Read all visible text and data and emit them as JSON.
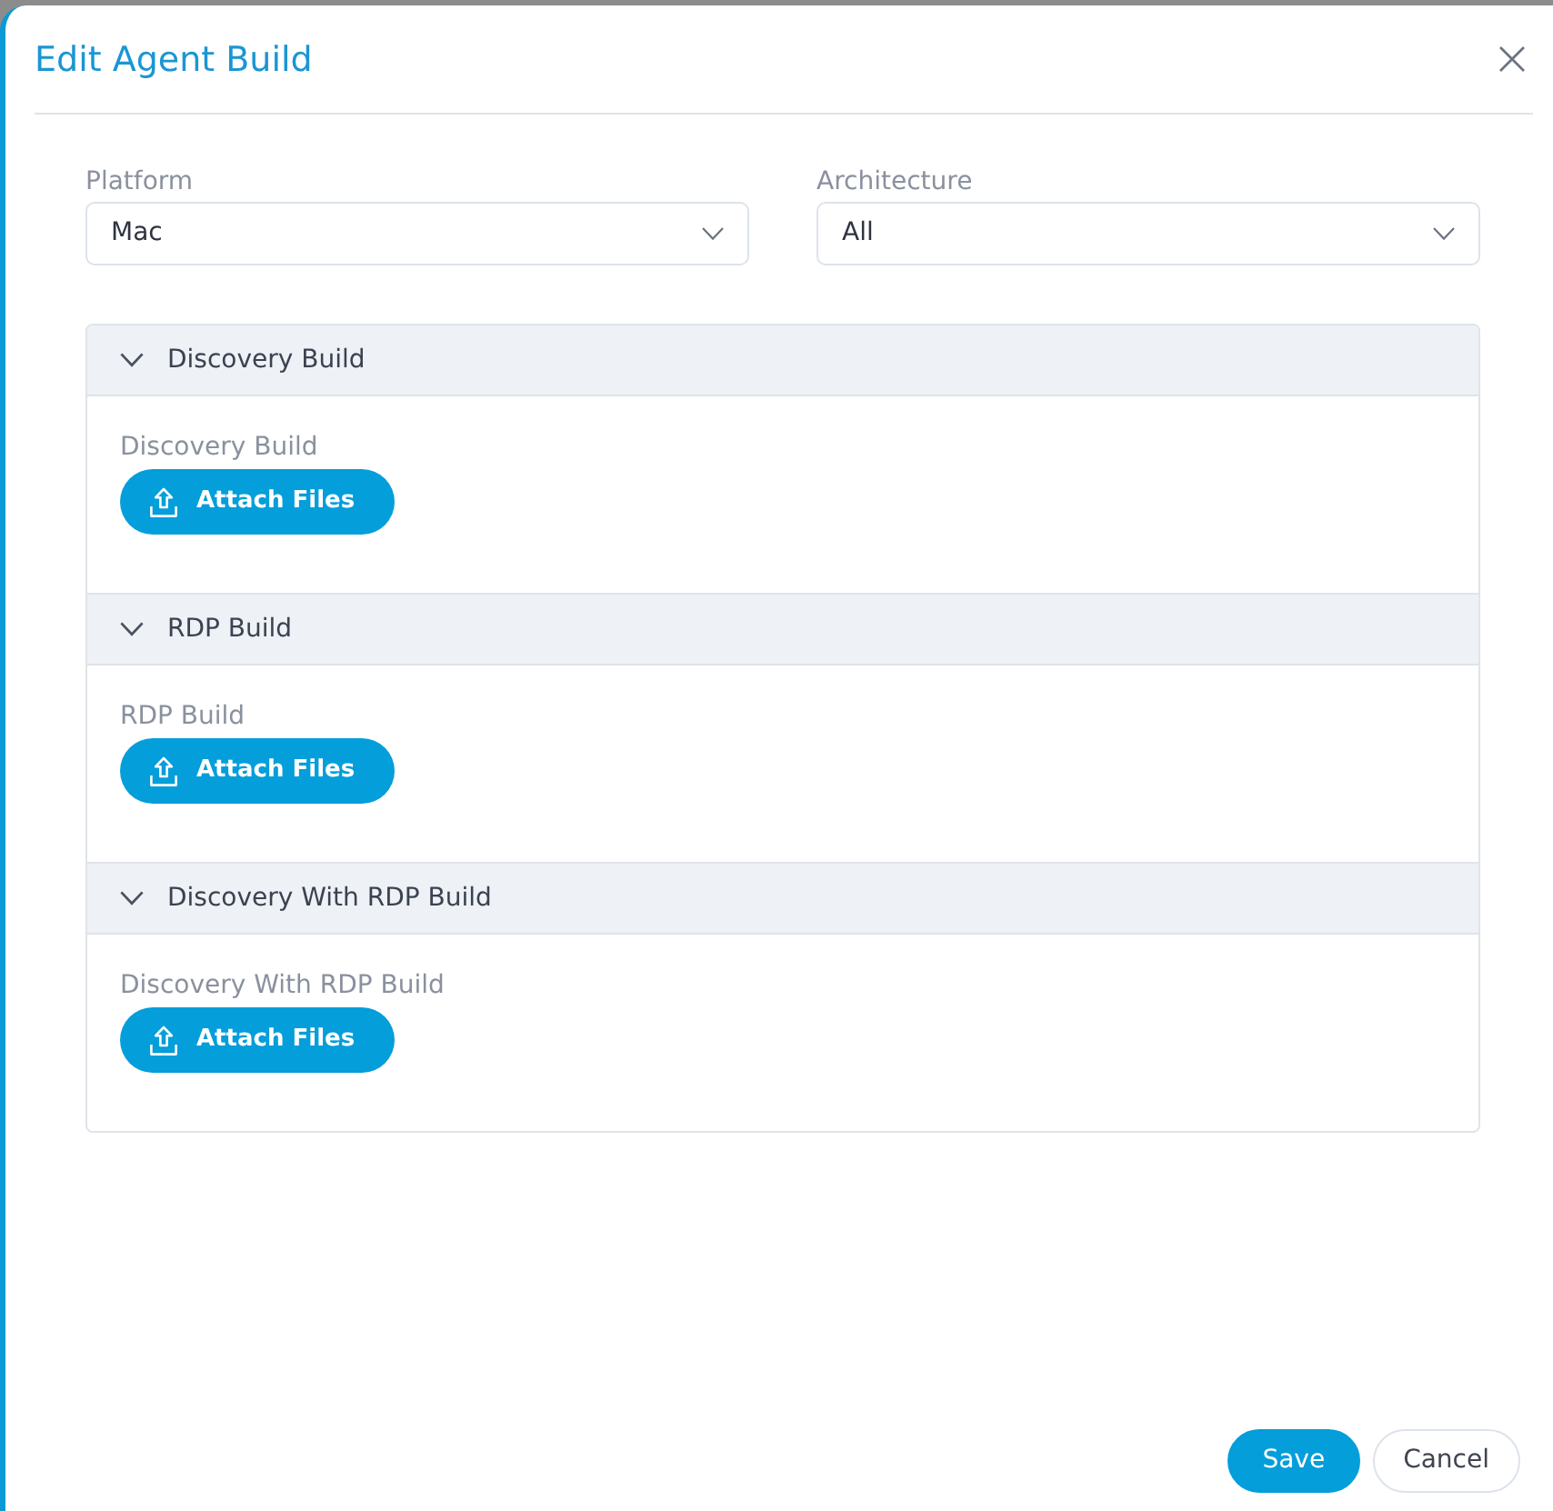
{
  "dialog": {
    "title": "Edit Agent Build"
  },
  "fields": [
    {
      "label": "Platform",
      "value": "Mac"
    },
    {
      "label": "Architecture",
      "value": "All"
    }
  ],
  "sections": [
    {
      "title": "Discovery Build",
      "expanded": true,
      "field_label": "Discovery Build",
      "button": "Attach Files"
    },
    {
      "title": "RDP Build",
      "expanded": true,
      "field_label": "RDP Build",
      "button": "Attach Files"
    },
    {
      "title": "Discovery With RDP Build",
      "expanded": true,
      "field_label": "Discovery With RDP Build",
      "button": "Attach Files"
    }
  ],
  "buttons": [
    {
      "label": "Save",
      "kind": "primary"
    },
    {
      "label": "Cancel",
      "kind": "secondary"
    }
  ]
}
